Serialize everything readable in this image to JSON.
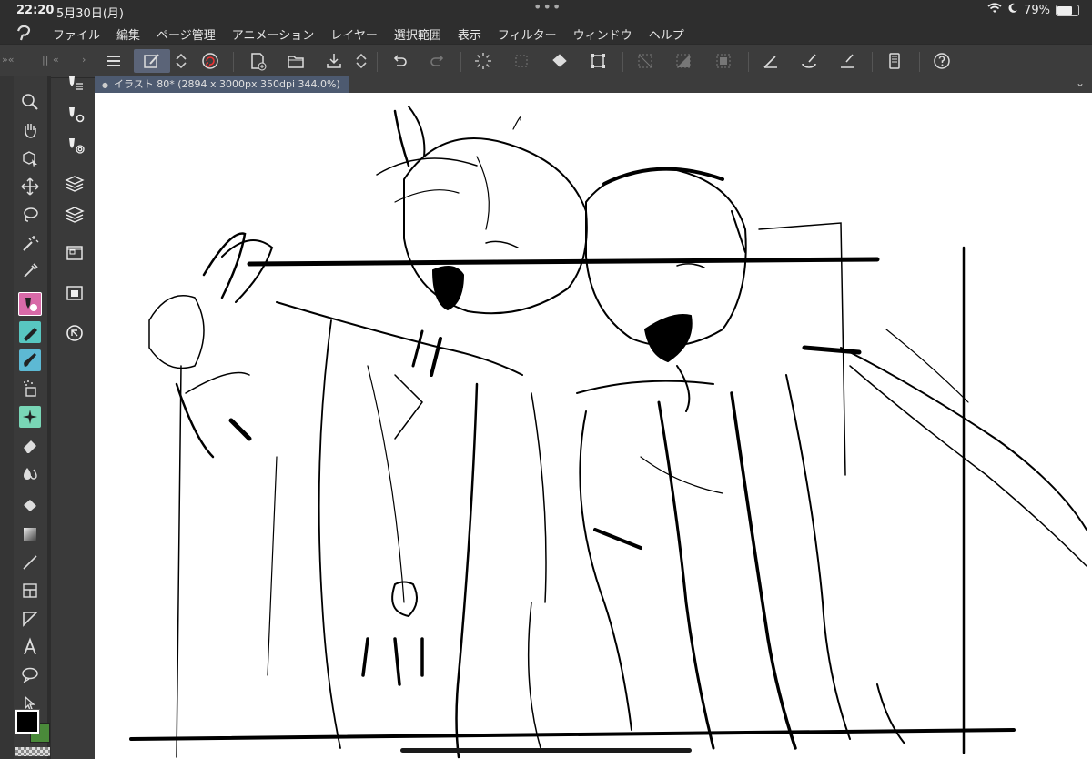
{
  "status": {
    "time": "22:20",
    "date": "5月30日(月)",
    "battery": "79%",
    "battery_level": 0.79
  },
  "menu": {
    "items": [
      "ファイル",
      "編集",
      "ページ管理",
      "アニメーション",
      "レイヤー",
      "選択範囲",
      "表示",
      "フィルター",
      "ウィンドウ",
      "ヘルプ"
    ]
  },
  "document": {
    "tab_title": "イラスト 80* (2894 x 3000px 350dpi 344.0%)"
  },
  "colors": {
    "main_color": "#000000",
    "sub_color": "#4a8a3a",
    "accent_tab": "#4d5a70"
  },
  "icons": {
    "command_bar": [
      "menu-icon",
      "edit-icon",
      "stepper-icon",
      "spiral-icon",
      "new-file-icon",
      "open-folder-icon",
      "save-icon",
      "stepper-icon",
      "undo-icon",
      "redo-icon",
      "busy-icon",
      "transform-icon",
      "fill-icon",
      "crop-icon",
      "hide-selection-icon",
      "fill-selection-icon",
      "select-all-icon",
      "ruler-pen-icon",
      "brush-icon",
      "ruler-icon",
      "device-icon",
      "help-icon"
    ],
    "tools": [
      "zoom-icon",
      "hand-icon",
      "object-icon",
      "move-icon",
      "lasso-icon",
      "magic-wand-icon",
      "eyedropper-icon",
      "pen-icon",
      "pencil-icon",
      "brush-icon",
      "airbrush-icon",
      "decoration-icon",
      "eraser-icon",
      "blend-icon",
      "fill-icon",
      "gradient-icon",
      "line-icon",
      "frame-icon",
      "ruler-icon",
      "text-icon",
      "balloon-icon",
      "correct-line-icon"
    ],
    "sub_panels": [
      "subtool-pen-icon",
      "subtool-settings-icon",
      "subtool-detail-icon",
      "layer-property-icon",
      "layer-icon",
      "material-icon",
      "navigator-icon",
      "history-icon"
    ]
  }
}
